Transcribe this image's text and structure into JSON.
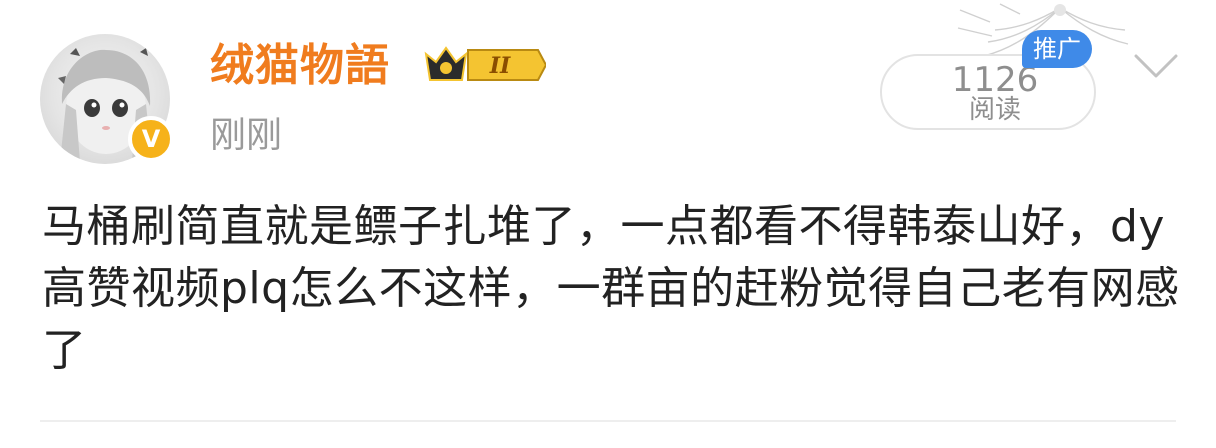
{
  "post": {
    "author": {
      "name": "绒猫物語",
      "level_badge": "II",
      "verified_mark": "V"
    },
    "timestamp": "刚刚",
    "stats": {
      "read_count": "1126",
      "read_label": "阅读"
    },
    "promo_tag": "推广",
    "content": "马桶刷简直就是鳔子扎堆了，一点都看不得韩泰山好，dy高赞视频plq怎么不这样，一群亩的赶粉觉得自己老有网感了"
  },
  "icons": {
    "avatar": "anime-girl-avatar",
    "verify": "verified-v-badge-icon",
    "crown": "crown-level-icon",
    "chevron": "chevron-down-icon",
    "decoration": "wing-decoration-icon"
  },
  "colors": {
    "username": "#f07c1e",
    "timestamp": "#9a9a9a",
    "promo_bg": "#3f8ae8",
    "badge_gold": "#f6b21a",
    "text": "#222222"
  }
}
